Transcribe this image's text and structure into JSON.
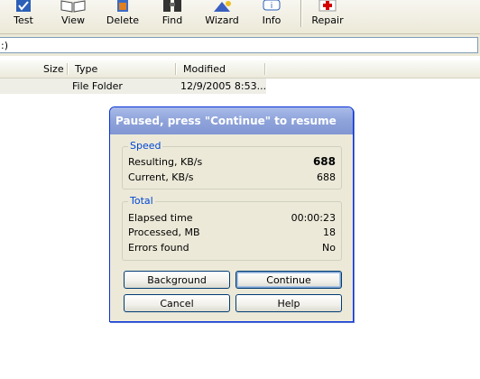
{
  "toolbar": {
    "buttons": [
      {
        "label": "Test",
        "icon": "checklist-icon"
      },
      {
        "label": "View",
        "icon": "book-icon"
      },
      {
        "label": "Delete",
        "icon": "delete-icon"
      },
      {
        "label": "Find",
        "icon": "binoculars-icon"
      },
      {
        "label": "Wizard",
        "icon": "wizard-icon"
      },
      {
        "label": "Info",
        "icon": "info-icon"
      },
      {
        "label": "Repair",
        "icon": "first-aid-icon"
      }
    ]
  },
  "address": {
    "value": ":)"
  },
  "list": {
    "columns": [
      "Size",
      "Type",
      "Modified"
    ],
    "rows": [
      {
        "size": "",
        "type": "File Folder",
        "modified": "12/9/2005 8:53..."
      }
    ]
  },
  "dialog": {
    "title": "Paused, press \"Continue\" to resume",
    "speed": {
      "title": "Speed",
      "resulting_label": "Resulting, KB/s",
      "resulting_value": "688",
      "current_label": "Current, KB/s",
      "current_value": "688"
    },
    "total": {
      "title": "Total",
      "elapsed_label": "Elapsed time",
      "elapsed_value": "00:00:23",
      "processed_label": "Processed, MB",
      "processed_value": "18",
      "errors_label": "Errors found",
      "errors_value": "No"
    },
    "buttons": {
      "background": "Background",
      "continue": "Continue",
      "cancel": "Cancel",
      "help": "Help"
    }
  },
  "colors": {
    "titlebar": "#8ea3da",
    "group_title": "#0046d5",
    "dialog_bg": "#ece9d8",
    "repair_accent": "#d40000"
  }
}
